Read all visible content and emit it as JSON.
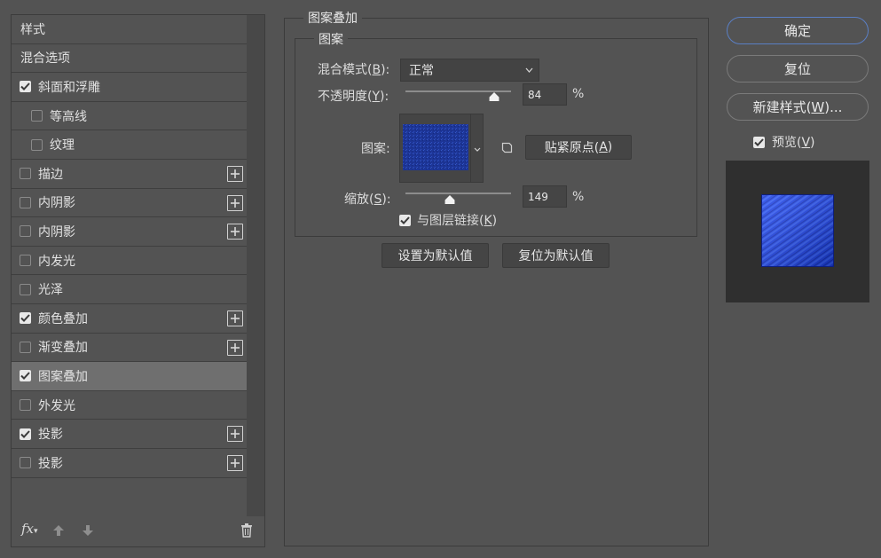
{
  "left_panel": {
    "header": "样式",
    "blend_options": "混合选项",
    "items": [
      {
        "label": "斜面和浮雕",
        "checked": true,
        "indent": false,
        "plus": false
      },
      {
        "label": "等高线",
        "checked": false,
        "indent": true,
        "plus": false
      },
      {
        "label": "纹理",
        "checked": false,
        "indent": true,
        "plus": false
      },
      {
        "label": "描边",
        "checked": false,
        "indent": false,
        "plus": true
      },
      {
        "label": "内阴影",
        "checked": false,
        "indent": false,
        "plus": true
      },
      {
        "label": "内阴影",
        "checked": false,
        "indent": false,
        "plus": true
      },
      {
        "label": "内发光",
        "checked": false,
        "indent": false,
        "plus": false
      },
      {
        "label": "光泽",
        "checked": false,
        "indent": false,
        "plus": false
      },
      {
        "label": "颜色叠加",
        "checked": true,
        "indent": false,
        "plus": true
      },
      {
        "label": "渐变叠加",
        "checked": false,
        "indent": false,
        "plus": true
      },
      {
        "label": "图案叠加",
        "checked": true,
        "indent": false,
        "plus": false,
        "selected": true
      },
      {
        "label": "外发光",
        "checked": false,
        "indent": false,
        "plus": false
      },
      {
        "label": "投影",
        "checked": true,
        "indent": false,
        "plus": true
      },
      {
        "label": "投影",
        "checked": false,
        "indent": false,
        "plus": true
      }
    ],
    "footer": {
      "fx_label": "fx"
    }
  },
  "pattern_overlay": {
    "section_title": "图案叠加",
    "subsection_title": "图案",
    "blend_mode_label": "混合模式(",
    "blend_mode_key": "B",
    "blend_mode_value": "正常",
    "opacity_label": "不透明度(",
    "opacity_key": "Y",
    "opacity_value": "84",
    "opacity_unit": "%",
    "opacity_fraction": 0.84,
    "pattern_label": "图案:",
    "snap_origin_label": "贴紧原点(",
    "snap_origin_key": "A",
    "scale_label": "缩放(",
    "scale_key": "S",
    "scale_value": "149",
    "scale_unit": "%",
    "scale_fraction": 0.42,
    "link_layer_label": "与图层链接(",
    "link_layer_key": "K",
    "link_layer_checked": true,
    "set_default_label": "设置为默认值",
    "reset_default_label": "复位为默认值"
  },
  "right_panel": {
    "ok_label": "确定",
    "reset_label": "复位",
    "new_style_label": "新建样式(",
    "new_style_key": "W",
    "new_style_suffix": ")...",
    "preview_label": "预览(",
    "preview_key": "V",
    "preview_checked": true
  },
  "colors": {
    "pattern_blue": "#1f3aa8",
    "preview_blue": "#1a3fe6",
    "accent_border": "#5a7fc4"
  }
}
